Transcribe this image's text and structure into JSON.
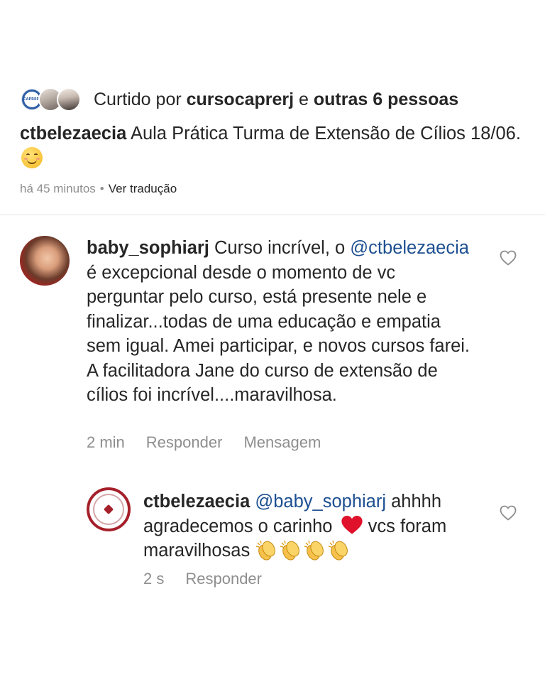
{
  "likes": {
    "prefix": "Curtido por ",
    "first_user": "cursocaprerj",
    "connector": " e ",
    "others": "outras 6 pessoas",
    "avatar1_label": "CAPRERJ"
  },
  "caption": {
    "user": "ctbelezaecia",
    "text": " Aula Prática Turma de Extensão de Cílios 18/06. "
  },
  "meta": {
    "time": "há 45 minutos",
    "separator": "•",
    "translate": "Ver tradução"
  },
  "comments": [
    {
      "user": "baby_sophiarj",
      "text_before": " Curso incrível, o ",
      "mention": "@ctbelezaecia",
      "text_after": " é excepcional desde o momento de vc perguntar pelo curso, está presente nele e finalizar...todas de uma educação e empatia sem igual. Amei participar, e novos cursos farei. A facilitadora Jane do curso de extensão de cílios foi incrível....maravilhosa.",
      "time": "2 min",
      "reply": "Responder",
      "message": "Mensagem"
    },
    {
      "user": "ctbelezaecia",
      "mention": "@baby_sophiarj",
      "text_before": " ahhhh agradecemos o carinho ",
      "text_after": " vcs foram maravilhosas ",
      "time": "2 s",
      "reply": "Responder"
    }
  ],
  "colors": {
    "text": "#262626",
    "muted": "#8e8e8e",
    "mention": "#1d4f91",
    "heart": "#e0112b"
  }
}
